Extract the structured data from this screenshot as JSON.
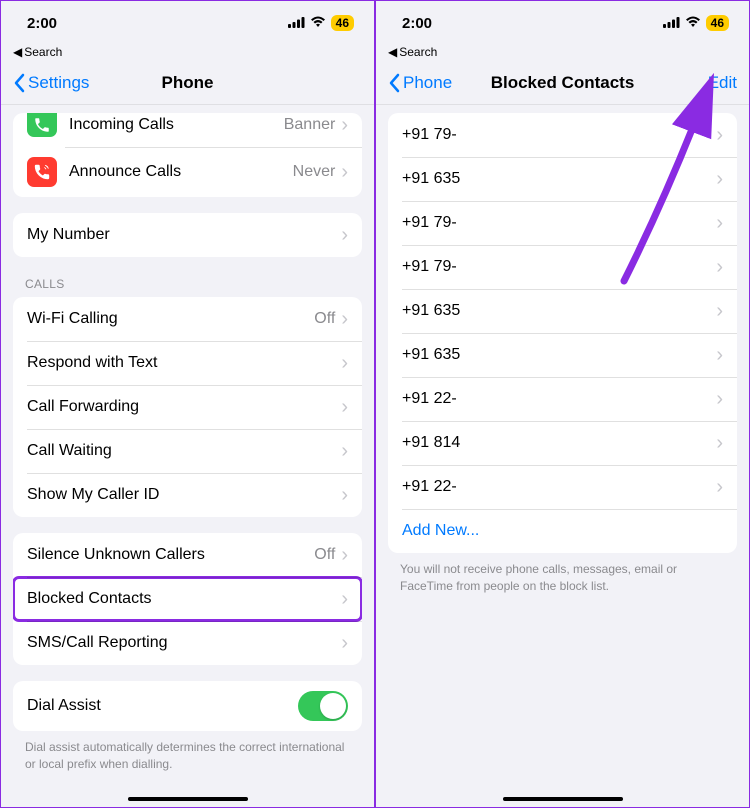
{
  "left": {
    "status": {
      "time": "2:00",
      "battery": "46"
    },
    "breadcrumb": "Search",
    "nav": {
      "back": "Settings",
      "title": "Phone"
    },
    "groupTop": [
      {
        "icon": "phone-in",
        "iconColor": "#34c759",
        "label": "Incoming Calls",
        "value": "Banner"
      },
      {
        "icon": "announce",
        "iconColor": "#ff3b30",
        "label": "Announce Calls",
        "value": "Never"
      }
    ],
    "myNumber": {
      "label": "My Number"
    },
    "callsHeader": "CALLS",
    "calls": [
      {
        "label": "Wi-Fi Calling",
        "value": "Off"
      },
      {
        "label": "Respond with Text"
      },
      {
        "label": "Call Forwarding"
      },
      {
        "label": "Call Waiting"
      },
      {
        "label": "Show My Caller ID"
      }
    ],
    "group3": [
      {
        "label": "Silence Unknown Callers",
        "value": "Off"
      },
      {
        "label": "Blocked Contacts",
        "highlight": true
      },
      {
        "label": "SMS/Call Reporting"
      }
    ],
    "dialAssist": {
      "label": "Dial Assist"
    },
    "dialAssistFooter": "Dial assist automatically determines the correct international or local prefix when dialling."
  },
  "right": {
    "status": {
      "time": "2:00",
      "battery": "46"
    },
    "breadcrumb": "Search",
    "nav": {
      "back": "Phone",
      "title": "Blocked Contacts",
      "action": "Edit"
    },
    "blocked": [
      "+91 79-",
      "+91 635",
      "+91 79-",
      "+91 79-",
      "+91 635",
      "+91 635",
      "+91 22-",
      "+91 814",
      "+91 22-"
    ],
    "addNew": "Add New...",
    "footer": "You will not receive phone calls, messages, email or FaceTime from people on the block list."
  }
}
